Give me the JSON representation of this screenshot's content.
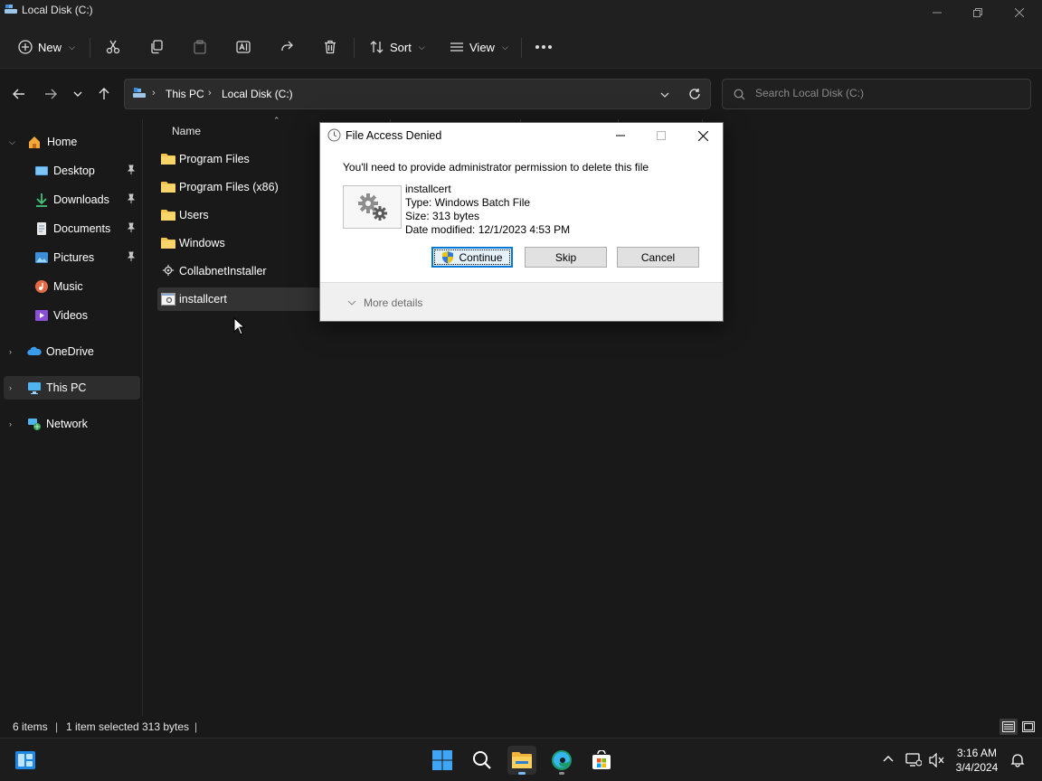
{
  "window": {
    "title": "Local Disk (C:)"
  },
  "commandbar": {
    "new_label": "New",
    "sort_label": "Sort",
    "view_label": "View"
  },
  "address": {
    "crumbs": [
      "This PC",
      "Local Disk (C:)"
    ],
    "search_placeholder": "Search Local Disk (C:)"
  },
  "sidebar": {
    "items": [
      {
        "label": "Home",
        "icon": "home-icon"
      },
      {
        "label": "Desktop",
        "icon": "desktop-icon",
        "pinned": true
      },
      {
        "label": "Downloads",
        "icon": "downloads-icon",
        "pinned": true
      },
      {
        "label": "Documents",
        "icon": "documents-icon",
        "pinned": true
      },
      {
        "label": "Pictures",
        "icon": "pictures-icon",
        "pinned": true
      },
      {
        "label": "Music",
        "icon": "music-icon"
      },
      {
        "label": "Videos",
        "icon": "videos-icon"
      },
      {
        "label": "OneDrive",
        "icon": "onedrive-icon"
      },
      {
        "label": "This PC",
        "icon": "this-pc-icon",
        "selected": true
      },
      {
        "label": "Network",
        "icon": "network-icon"
      }
    ]
  },
  "content": {
    "column_name": "Name",
    "files": [
      {
        "name": "Program Files",
        "type": "folder"
      },
      {
        "name": "Program Files (x86)",
        "type": "folder"
      },
      {
        "name": "Users",
        "type": "folder"
      },
      {
        "name": "Windows",
        "type": "folder"
      },
      {
        "name": "CollabnetInstaller",
        "type": "installer"
      },
      {
        "name": "installcert",
        "type": "batch",
        "selected": true
      }
    ]
  },
  "status": {
    "item_count": "6 items",
    "selection": "1 item selected",
    "size": "313 bytes"
  },
  "dialog": {
    "title": "File Access Denied",
    "message": "You'll need to provide administrator permission to delete this file",
    "file_name": "installcert",
    "file_type": "Type: Windows Batch File",
    "file_size": "Size: 313 bytes",
    "file_modified": "Date modified: 12/1/2023 4:53 PM",
    "continue_label": "Continue",
    "skip_label": "Skip",
    "cancel_label": "Cancel",
    "more_details_label": "More details"
  },
  "taskbar": {
    "time": "3:16 AM",
    "date": "3/4/2024"
  },
  "colors": {
    "accent": "#0078d7",
    "folder": "#f2c44e",
    "background": "#191919"
  }
}
